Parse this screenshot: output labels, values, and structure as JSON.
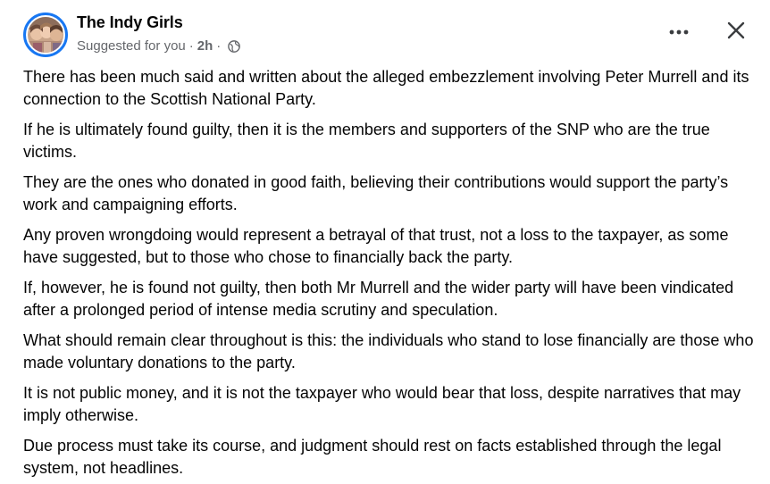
{
  "author": {
    "name": "The Indy Girls",
    "avatar_icon": "group-photo-avatar"
  },
  "meta": {
    "suggested": "Suggested for you",
    "separator": "·",
    "time": "2h",
    "audience_icon": "globe-icon"
  },
  "actions": {
    "more_icon": "more-options-icon",
    "close_icon": "close-icon"
  },
  "post": {
    "paragraphs": [
      "There has been much said and written about the alleged embezzlement involving Peter Murrell and its connection to the Scottish National Party.",
      "If he is ultimately found guilty, then it is the members and supporters of the SNP who are the true victims.",
      "They are the ones who donated in good faith, believing their contributions would support the party’s work and campaigning efforts.",
      "Any proven wrongdoing would represent a betrayal of that trust, not a loss to the taxpayer, as some have suggested, but to those who chose to financially back the party.",
      "If, however, he is found not guilty, then both Mr Murrell and the wider party will have been vindicated after a prolonged period of intense media scrutiny and speculation.",
      "What should remain clear throughout is this: the individuals who stand to lose financially are those who made voluntary donations to the party.",
      "It is not public money, and it is not the taxpayer who would bear that loss, despite narratives that may imply otherwise.",
      "Due process must take its course, and judgment should rest on facts established through the legal system, not headlines."
    ]
  },
  "colors": {
    "avatar_ring": "#1877f2",
    "secondary_text": "#65676b",
    "primary_text": "#050505",
    "icon": "#3b3d40"
  }
}
